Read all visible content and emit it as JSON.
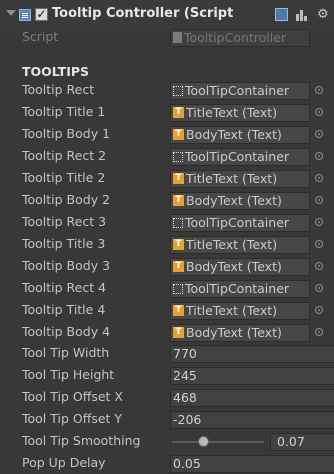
{
  "header": {
    "title": "Tooltip Controller (Script",
    "checkbox_mark": "✓"
  },
  "script_row": {
    "label": "Script",
    "value": "TooltipController"
  },
  "section_title": "TOOLTIPS",
  "object_fields": [
    {
      "label": "Tooltip Rect",
      "value": "ToolTipContainer",
      "icon": "rect-transform-icon"
    },
    {
      "label": "Tooltip Title 1",
      "value": "TitleText (Text)",
      "icon": "text-icon"
    },
    {
      "label": "Tooltip Body 1",
      "value": "BodyText (Text)",
      "icon": "text-icon"
    },
    {
      "label": "Tooltip Rect 2",
      "value": "ToolTipContainer",
      "icon": "rect-transform-icon"
    },
    {
      "label": "Tooltip Title 2",
      "value": "TitleText (Text)",
      "icon": "text-icon"
    },
    {
      "label": "Tooltip Body 2",
      "value": "BodyText (Text)",
      "icon": "text-icon"
    },
    {
      "label": "Tooltip Rect 3",
      "value": "ToolTipContainer",
      "icon": "rect-transform-icon"
    },
    {
      "label": "Tooltip Title 3",
      "value": "TitleText (Text)",
      "icon": "text-icon"
    },
    {
      "label": "Tooltip Body 3",
      "value": "BodyText (Text)",
      "icon": "text-icon"
    },
    {
      "label": "Tooltip Rect 4",
      "value": "ToolTipContainer",
      "icon": "rect-transform-icon"
    },
    {
      "label": "Tooltip Title 4",
      "value": "TitleText (Text)",
      "icon": "text-icon"
    },
    {
      "label": "Tooltip Body 4",
      "value": "BodyText (Text)",
      "icon": "text-icon"
    }
  ],
  "number_fields": [
    {
      "label": "Tool Tip Width",
      "value": "770"
    },
    {
      "label": "Tool Tip Height",
      "value": "245"
    },
    {
      "label": "Tool Tip Offset X",
      "value": "468"
    },
    {
      "label": "Tool Tip Offset Y",
      "value": "-206"
    }
  ],
  "smoothing": {
    "label": "Tool Tip Smoothing",
    "value": "0.07"
  },
  "popup_delay": {
    "label": "Pop Up Delay",
    "value": "0.05"
  }
}
